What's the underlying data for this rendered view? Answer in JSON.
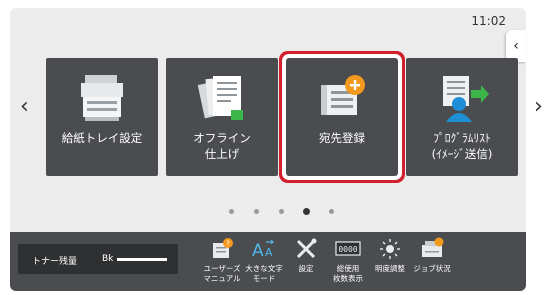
{
  "clock": "11:02",
  "side_tab_icon": "chevron-left-icon",
  "nav": {
    "prev_icon": "chevron-left-icon",
    "next_icon": "chevron-right-icon"
  },
  "tiles": [
    {
      "label": "給紙トレイ設定",
      "icon": "printer-icon"
    },
    {
      "label": "オフライン\n仕上げ",
      "icon": "document-stack-icon"
    },
    {
      "label": "宛先登録",
      "icon": "address-book-add-icon",
      "selected": true
    },
    {
      "label": "ﾌﾟﾛｸﾞﾗﾑﾘｽﾄ\n(ｲﾒｰｼﾞ送信)",
      "icon": "program-list-send-icon"
    }
  ],
  "pagination": {
    "count": 5,
    "active": 4
  },
  "toner": {
    "label": "トナー残量",
    "color": "Bk",
    "level_percent": 100
  },
  "tools": [
    {
      "label": "ユーザーズ\nマニュアル",
      "icon": "manual-icon"
    },
    {
      "label": "大きな文字\nモード",
      "icon": "large-text-icon"
    },
    {
      "label": "設定",
      "icon": "wrench-icon"
    },
    {
      "label": "総使用\n枚数表示",
      "icon": "counter-icon"
    },
    {
      "label": "明度調整",
      "icon": "brightness-icon"
    },
    {
      "label": "ジョブ状況",
      "icon": "job-status-icon"
    }
  ],
  "colors": {
    "tile": "#4a4c4f",
    "highlight": "#d21f2d",
    "accent_orange": "#f39a1e",
    "accent_green": "#3cb54a",
    "accent_blue": "#1e8fd6"
  }
}
